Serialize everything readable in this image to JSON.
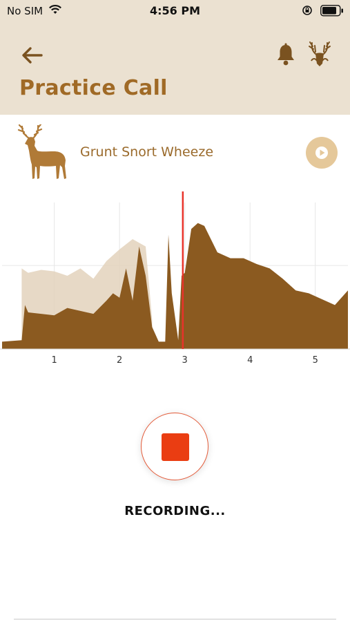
{
  "status_bar": {
    "carrier": "No SIM",
    "time": "4:56 PM"
  },
  "header": {
    "title": "Practice Call",
    "back_icon": "arrow-left-icon",
    "notification_icon": "bell-icon",
    "logo_icon": "deer-antlers-logo-icon"
  },
  "call": {
    "name": "Grunt Snort Wheeze",
    "thumbnail_icon": "deer-icon",
    "play_icon": "play-icon"
  },
  "colors": {
    "brand": "#a06a26",
    "header_bg": "#ebe1d1",
    "waveform": "#8b5a20",
    "playhead": "#e8332a",
    "stop": "#ea3d12"
  },
  "chart_data": {
    "type": "area",
    "x_ticks": [
      "1",
      "2",
      "3",
      "4",
      "5"
    ],
    "x_range": [
      0.2,
      5.5
    ],
    "y_range": [
      0,
      1
    ],
    "playhead": 2.97,
    "grid": true,
    "series": [
      {
        "x": [
          0.2,
          0.5,
          0.55,
          0.6,
          0.8,
          1.0,
          1.2,
          1.4,
          1.6,
          1.8,
          1.9,
          2.0,
          2.1,
          2.2,
          2.3,
          2.4,
          2.5,
          2.6,
          2.7,
          2.75,
          2.8,
          2.9,
          2.95,
          3.0,
          3.1,
          3.2,
          3.3,
          3.5,
          3.7,
          3.9,
          4.1,
          4.3,
          4.5,
          4.7,
          4.9,
          5.1,
          5.3,
          5.5
        ],
        "values": [
          0.05,
          0.06,
          0.3,
          0.25,
          0.24,
          0.23,
          0.28,
          0.26,
          0.24,
          0.33,
          0.38,
          0.35,
          0.55,
          0.33,
          0.7,
          0.5,
          0.15,
          0.05,
          0.05,
          0.78,
          0.38,
          0.06,
          0.5,
          0.52,
          0.82,
          0.86,
          0.84,
          0.66,
          0.62,
          0.62,
          0.58,
          0.55,
          0.48,
          0.4,
          0.38,
          0.34,
          0.3,
          0.4
        ]
      },
      {
        "x": [
          0.5,
          0.6,
          0.8,
          1.0,
          1.2,
          1.4,
          1.6,
          1.8,
          2.0,
          2.2,
          2.4,
          2.5
        ],
        "values": [
          0.55,
          0.52,
          0.54,
          0.53,
          0.5,
          0.55,
          0.48,
          0.6,
          0.68,
          0.75,
          0.7,
          0.2
        ]
      }
    ]
  },
  "recording": {
    "label": "RECORDING..."
  }
}
